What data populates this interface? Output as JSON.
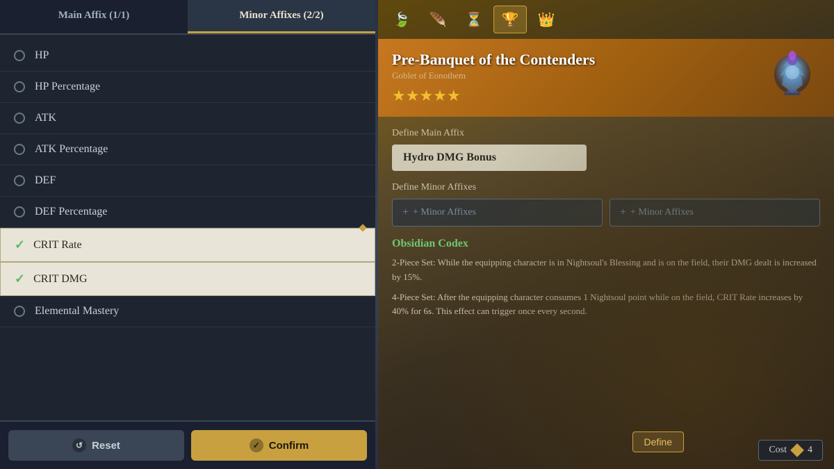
{
  "tabs": {
    "main_affix": "Main Affix (1/1)",
    "minor_affixes": "Minor Affixes (2/2)",
    "active_tab": "minor_affixes"
  },
  "affix_items": [
    {
      "id": "hp",
      "label": "HP",
      "selected": false
    },
    {
      "id": "hp_pct",
      "label": "HP Percentage",
      "selected": false
    },
    {
      "id": "atk",
      "label": "ATK",
      "selected": false
    },
    {
      "id": "atk_pct",
      "label": "ATK Percentage",
      "selected": false
    },
    {
      "id": "def",
      "label": "DEF",
      "selected": false
    },
    {
      "id": "def_pct",
      "label": "DEF Percentage",
      "selected": false
    },
    {
      "id": "crit_rate",
      "label": "CRIT Rate",
      "selected": true
    },
    {
      "id": "crit_dmg",
      "label": "CRIT DMG",
      "selected": true
    },
    {
      "id": "elemental_mastery",
      "label": "Elemental Mastery",
      "selected": false
    }
  ],
  "buttons": {
    "reset": "Reset",
    "confirm": "Confirm"
  },
  "right_panel": {
    "icon_tabs": [
      {
        "id": "flower",
        "icon": "🍃",
        "active": false
      },
      {
        "id": "feather",
        "icon": "🪶",
        "active": false
      },
      {
        "id": "hourglass",
        "icon": "⏳",
        "active": false
      },
      {
        "id": "goblet",
        "icon": "🏆",
        "active": true
      },
      {
        "id": "crown",
        "icon": "👑",
        "active": false
      }
    ],
    "item_name": "Pre-Banquet of the Contenders",
    "item_subtitle": "Goblet of Eonothem",
    "stars": "★★★★★",
    "define_main_affix_label": "Define Main Affix",
    "main_affix_value": "Hydro DMG Bonus",
    "define_minor_affixes_label": "Define Minor Affixes",
    "minor_affix_slot_1": "+ Minor Affixes",
    "minor_affix_slot_2": "+ Minor Affixes",
    "set_bonus_title": "Obsidian Codex",
    "set_bonus_2pc": "2-Piece Set: While the equipping character is in Nightsoul's Blessing and is on the field, their DMG dealt is increased by 15%.",
    "set_bonus_4pc": "4-Piece Set: After the equipping character consumes 1 Nightsoul point while on the field, CRIT Rate increases by 40% for 6s. This effect can trigger once every second.",
    "cost_label": "Cost",
    "cost_value": "4",
    "define_btn": "Define"
  }
}
